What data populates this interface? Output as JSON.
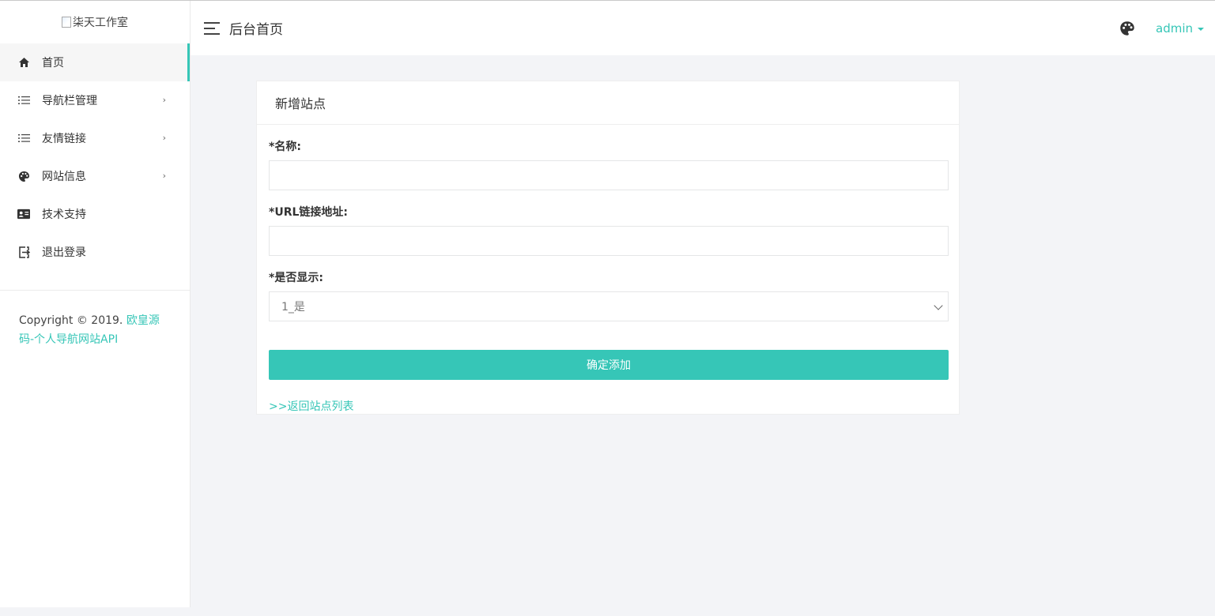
{
  "sidebar": {
    "logo_alt": "柒天工作室",
    "items": [
      {
        "label": "首页",
        "icon": "home-icon"
      },
      {
        "label": "导航栏管理",
        "icon": "list-icon"
      },
      {
        "label": "友情链接",
        "icon": "list-icon"
      },
      {
        "label": "网站信息",
        "icon": "palette-icon"
      },
      {
        "label": "技术支持",
        "icon": "id-card-icon"
      },
      {
        "label": "退出登录",
        "icon": "logout-icon"
      }
    ],
    "arrow": "›",
    "copyright_prefix": "Copyright © 2019.",
    "copyright_link": "欧皇源码-个人导航网站API"
  },
  "header": {
    "title": "后台首页",
    "user": "admin"
  },
  "form": {
    "title": "新增站点",
    "name_label": "*名称:",
    "name_value": "",
    "url_label": "*URL链接地址:",
    "url_value": "",
    "show_label": "*是否显示:",
    "show_selected": "1_是",
    "submit_label": "确定添加",
    "back_link": ">>返回站点列表"
  },
  "colors": {
    "accent": "#36c6b7",
    "background": "#f3f4f7"
  }
}
